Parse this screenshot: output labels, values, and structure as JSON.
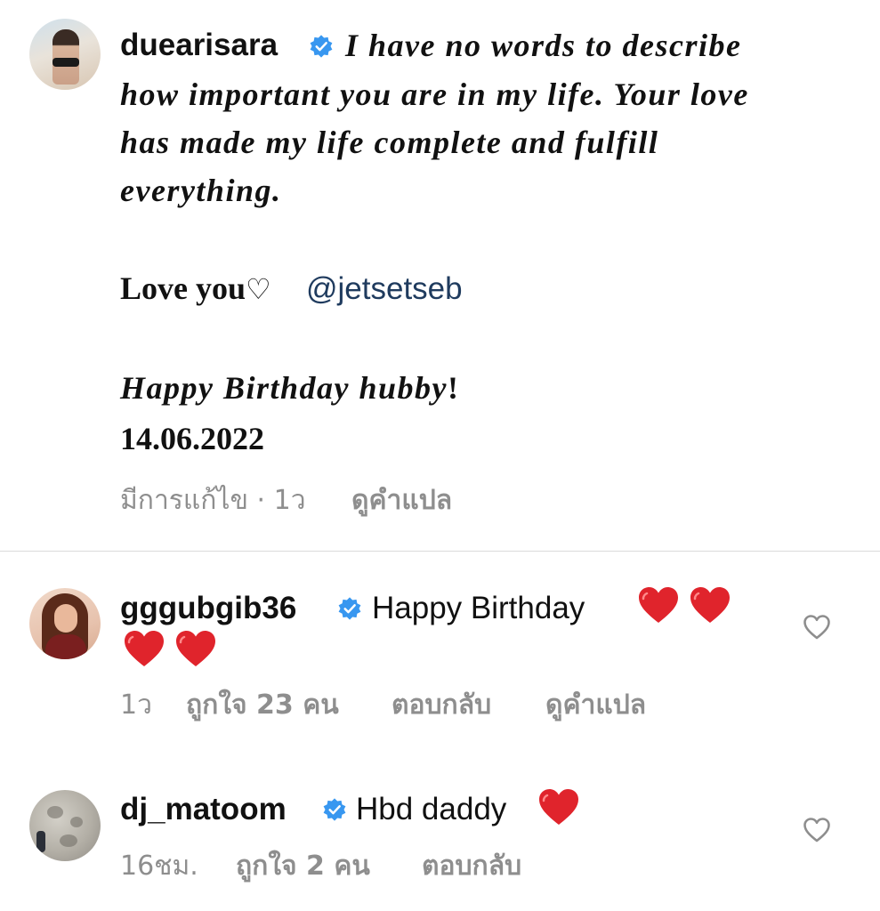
{
  "comments": [
    {
      "username": "duearisara",
      "caption_lines": [
        "I have no words to describe",
        "how important you are in my life. Your love",
        "has made my life complete and fulfill",
        "everything."
      ],
      "love_text": "Love you",
      "love_heart": "♡",
      "mention": "@jetsetseb",
      "birthday_text": "Happy Birthday hubby",
      "birthday_excl": "!",
      "date": "14.06.2022",
      "meta": {
        "edited": "มีการแก้ไข · 1ว",
        "translate": "ดูคำแปล"
      }
    },
    {
      "username": "gggubgib36",
      "text": "Happy Birthday",
      "heart_emoji_count": 4,
      "meta": {
        "time": "1ว",
        "likes": "ถูกใจ 23 คน",
        "reply": "ตอบกลับ",
        "translate": "ดูคำแปล"
      }
    },
    {
      "username": "dj_matoom",
      "text": "Hbd daddy",
      "heart_emoji_count": 1,
      "meta": {
        "time": "16ชม.",
        "likes": "ถูกใจ 2 คน",
        "reply": "ตอบกลับ"
      }
    }
  ],
  "colors": {
    "verified": "#3897f0",
    "heart_emoji": "#e0242c",
    "mention": "#1f3b5e",
    "meta_text": "#8e8e8e",
    "divider": "#dbdbdb"
  },
  "icons": {
    "verified": "verified-badge-icon",
    "like": "heart-outline-icon",
    "emoji": "red-heart-emoji-icon"
  }
}
